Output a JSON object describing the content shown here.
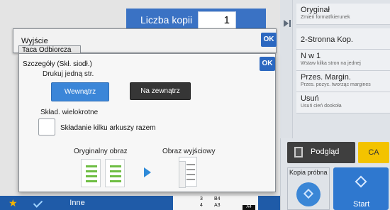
{
  "copies": {
    "label": "Liczba kopii",
    "value": "1"
  },
  "dialog_output": {
    "title": "Wyjście",
    "tab": "Taca Odbiorcza",
    "ok_label": "OK"
  },
  "dialog_details": {
    "title": "Szczegóły (Skł. siodł.)",
    "ok_label": "OK",
    "print_one_label": "Drukuj jedną str.",
    "inside_label": "Wewnątrz",
    "outside_label": "Na zewnątrz",
    "inside_selected": true,
    "multi_fold_label": "Skład. wielokrotne",
    "multi_fold_checkbox_label": "Składanie kilku arkuszy razem",
    "multi_fold_checked": false,
    "original_image_label": "Oryginalny obraz",
    "output_image_label": "Obraz wyjściowy"
  },
  "right_panel": {
    "items": [
      {
        "title": "Oryginał",
        "subtitle": "Zmień format/kierunek"
      },
      {
        "title": "2-Stronna Kop.",
        "subtitle": ""
      },
      {
        "title": "N w 1",
        "subtitle": "Wstaw kilka stron na jednej"
      },
      {
        "title": "Przes. Margin.",
        "subtitle": "Przes. pozyc. tworząc margines"
      },
      {
        "title": "Usuń",
        "subtitle": "Usuń cień dookoła"
      }
    ],
    "preview_label": "Podgląd",
    "ca_label": "CA",
    "proof_label": "Kopia próbna",
    "start_label": "Start"
  },
  "bottom_bar": {
    "other_label": "Inne",
    "trays": [
      {
        "num": "3",
        "size": "B4"
      },
      {
        "num": "4",
        "size": "A3"
      }
    ],
    "selected_size": "A4"
  },
  "colors": {
    "accent_blue": "#2c68c0",
    "selected_button": "#3b86d8",
    "ca_yellow": "#f3c300",
    "illustration_green": "#6fbe44"
  }
}
